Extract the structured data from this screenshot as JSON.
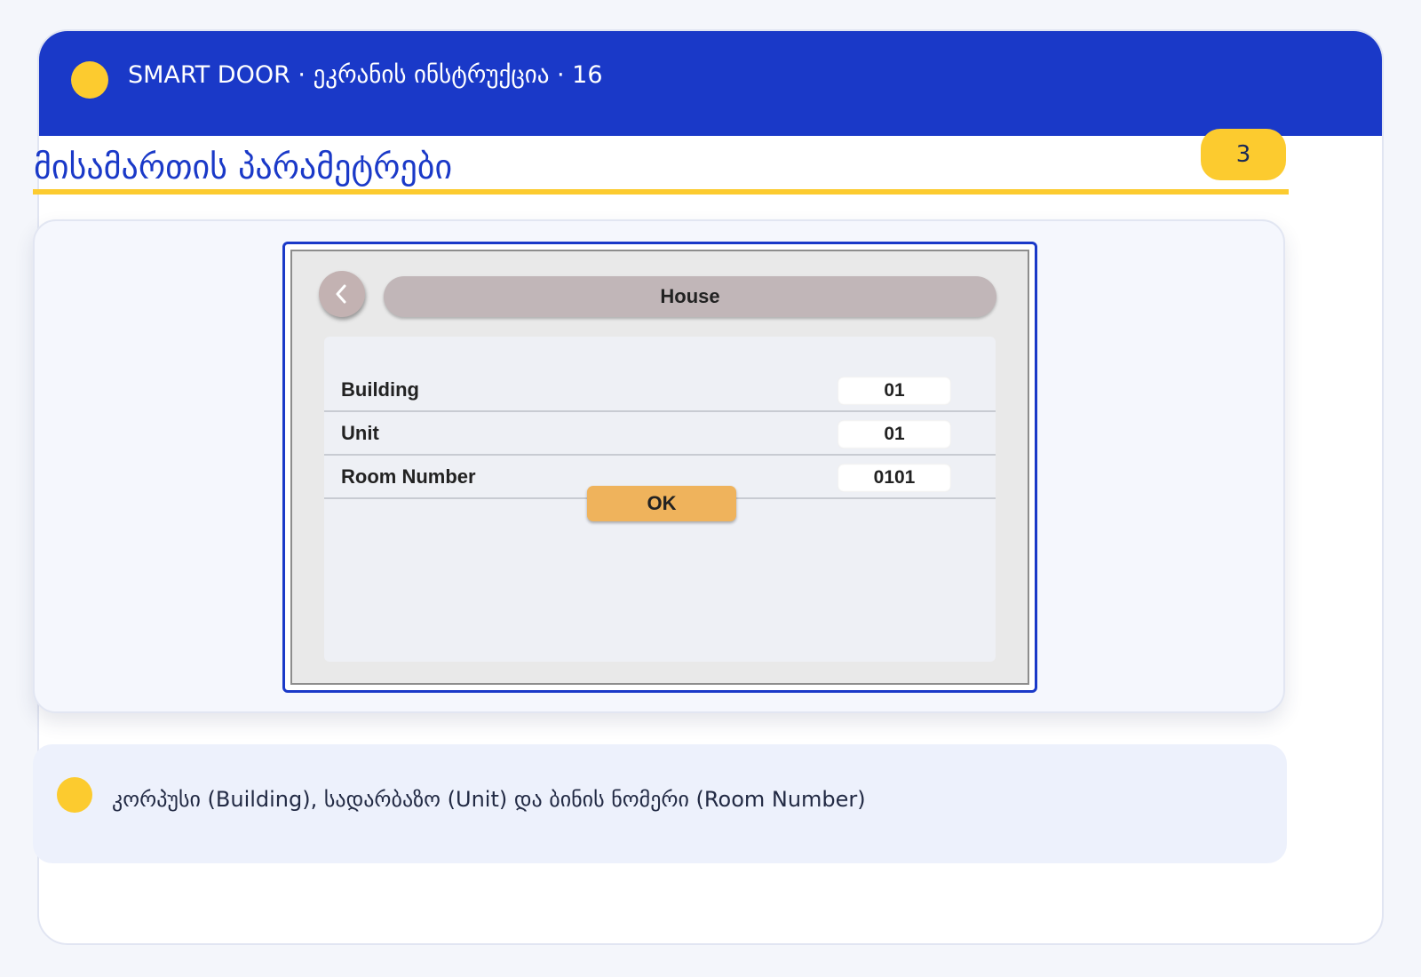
{
  "header": {
    "title": "SMART DOOR · ეკრანის ინსტრუქცია · 16"
  },
  "page": {
    "title": "მისამართის პარამეტრები",
    "step_number": "3"
  },
  "device_screen": {
    "back_icon": "chevron-left-icon",
    "title": "House",
    "rows": [
      {
        "label": "Building",
        "value": "01"
      },
      {
        "label": "Unit",
        "value": "01"
      },
      {
        "label": "Room Number",
        "value": "0101"
      }
    ],
    "ok_label": "OK"
  },
  "note": {
    "text": "კორპუსი (Building), სადარბაზო (Unit) და ბინის ნომერი (Room Number)"
  },
  "colors": {
    "header_blue": "#1a39c8",
    "accent_yellow": "#fccb2f",
    "ok_orange": "#efb35c",
    "device_title_bar": "#c1b6b8"
  }
}
